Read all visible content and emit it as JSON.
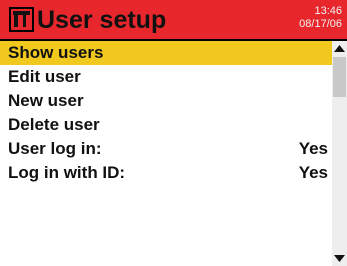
{
  "header": {
    "title": "User setup",
    "time": "13:46",
    "date": "08/17/06",
    "icon": "wrench-screwdriver-icon",
    "background_color": "#e8272c"
  },
  "menu": {
    "selected_color": "#f1c81e",
    "items": [
      {
        "label": "Show users",
        "value": ""
      },
      {
        "label": "Edit user",
        "value": ""
      },
      {
        "label": "New user",
        "value": ""
      },
      {
        "label": "Delete user",
        "value": ""
      },
      {
        "label": "User log in:",
        "value": "Yes"
      },
      {
        "label": "Log in with ID:",
        "value": "Yes"
      }
    ]
  },
  "scrollbar": {
    "up_icon": "arrow-up-icon",
    "down_icon": "arrow-down-icon"
  }
}
